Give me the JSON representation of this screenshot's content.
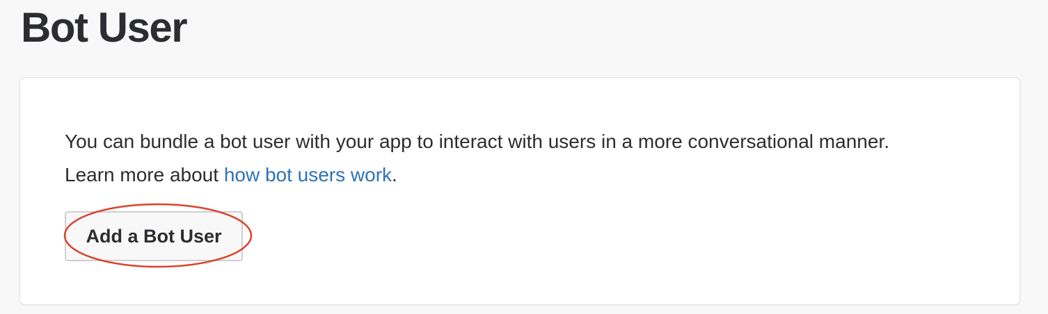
{
  "header": {
    "title": "Bot User"
  },
  "card": {
    "description_text": "You can bundle a bot user with your app to interact with users in a more conversational manner. Learn more about ",
    "description_link": "how bot users work",
    "description_end": ".",
    "button_label": "Add a Bot User"
  },
  "annotation": {
    "color": "#d9432a",
    "target": "add-bot-user-button"
  },
  "theme": {
    "link_color": "#2d72b8",
    "background": "#f8f8f8"
  }
}
